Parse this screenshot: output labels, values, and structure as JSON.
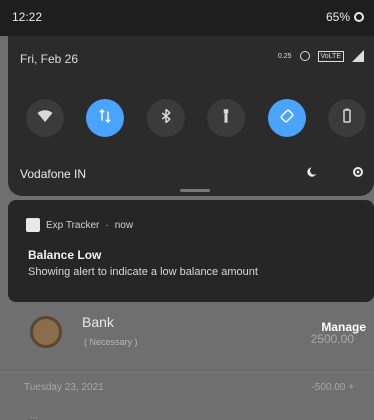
{
  "status_bar": {
    "time": "12:22",
    "battery": "65%"
  },
  "quick_settings": {
    "date": "Fri, Feb 26",
    "data_speed": "0.25",
    "volte_label": "VoLTE",
    "carrier": "Vodafone IN"
  },
  "notification": {
    "app_name": "Exp Tracker",
    "time": "now",
    "title": "Balance Low",
    "body": "Showing alert to indicate a low balance amount"
  },
  "background_app": {
    "account_name": "Bank",
    "account_sub": "( Necessary )",
    "amount": "2500.00",
    "manage_label": "Manage",
    "row2_left": "Tuesday 23, 2021",
    "row2_right": "-500.00 +",
    "row3_left": "..."
  },
  "icons": {
    "wifi": "wifi-icon",
    "mobile_data": "mobile-data-icon",
    "bluetooth": "bluetooth-icon",
    "flashlight": "flashlight-icon",
    "auto_rotate": "auto-rotate-icon",
    "battery_saver": "battery-saver-icon",
    "night_light": "night-light-icon",
    "settings": "settings-icon"
  },
  "colors": {
    "accent": "#4aa3ff",
    "panel": "#2b2b2b",
    "tile_inactive": "#3b3b3b"
  }
}
